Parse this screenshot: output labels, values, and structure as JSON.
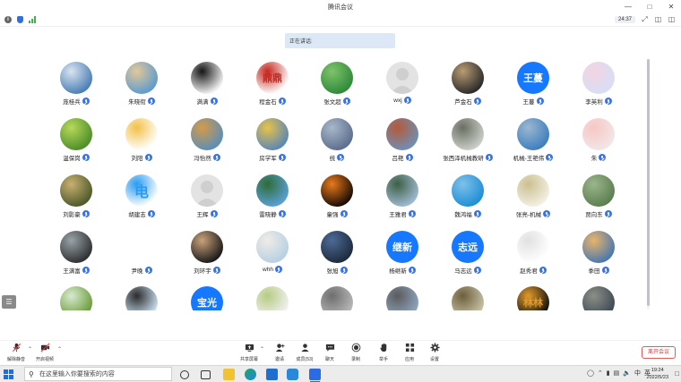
{
  "window": {
    "title": "腾讯会议",
    "timer": "24:37"
  },
  "speaking": {
    "label": "正在讲话:"
  },
  "participants": [
    {
      "name": "庞桂兵",
      "avatar": "sky-clouds",
      "colors": [
        "#4b7fb5",
        "#d9e4f0"
      ]
    },
    {
      "name": "朱晓衔",
      "avatar": "beach-person",
      "colors": [
        "#5e9bcf",
        "#e3c898"
      ]
    },
    {
      "name": "满满",
      "avatar": "black-cat",
      "colors": [
        "#f3f3f3",
        "#151515"
      ]
    },
    {
      "name": "程金石",
      "avatar": "red-seal",
      "colors": [
        "#ffffff",
        "#c4271e"
      ],
      "text": "鼎鼎",
      "text_color": "#c4271e"
    },
    {
      "name": "张文超",
      "avatar": "bamboo",
      "colors": [
        "#2f8a3a",
        "#7fc36a"
      ]
    },
    {
      "name": "wxj",
      "avatar": "default-person",
      "colors": [
        "#e3e3e3",
        "#c7c7c7"
      ]
    },
    {
      "name": "芦金石",
      "avatar": "person-portrait",
      "colors": [
        "#2b2b2b",
        "#b89b72"
      ]
    },
    {
      "name": "王蔓",
      "avatar": "text",
      "colors": [
        "#1677ff",
        "#1677ff"
      ],
      "text": "王蔓"
    },
    {
      "name": "李英利",
      "avatar": "cartoon-girl",
      "colors": [
        "#d7def6",
        "#f3d4e2"
      ]
    },
    {
      "name": "温保岗",
      "avatar": "green-leaf",
      "colors": [
        "#4d8f2a",
        "#b7d95a"
      ]
    },
    {
      "name": "刘阳",
      "avatar": "baby-crown",
      "colors": [
        "#ffffff",
        "#f2c14b"
      ]
    },
    {
      "name": "冯怡然",
      "avatar": "painting",
      "colors": [
        "#5b8fb7",
        "#d49a4a"
      ]
    },
    {
      "name": "房学军",
      "avatar": "sunflower-burst",
      "colors": [
        "#5b87b8",
        "#e7c24a"
      ]
    },
    {
      "name": "统",
      "avatar": "sea-dusk",
      "colors": [
        "#5d6f8f",
        "#a8b7c9"
      ]
    },
    {
      "name": "吕艳",
      "avatar": "temple",
      "colors": [
        "#6f8fb5",
        "#b45a3a"
      ]
    },
    {
      "name": "张西泽机械教研",
      "avatar": "stone-arch",
      "colors": [
        "#c9cfc8",
        "#6b6f63"
      ]
    },
    {
      "name": "机械-王艳伟",
      "avatar": "city-lake",
      "colors": [
        "#3f7fbf",
        "#9cb7d0"
      ]
    },
    {
      "name": "朱",
      "avatar": "cartoon-kid",
      "colors": [
        "#f2e6e6",
        "#f6c7c4"
      ]
    },
    {
      "name": "刘影豪",
      "avatar": "field",
      "colors": [
        "#4e5a2c",
        "#c9b070"
      ]
    },
    {
      "name": "胡建志",
      "avatar": "blue-char",
      "colors": [
        "#ffffff",
        "#2a9bf0"
      ],
      "text": "电",
      "text_color": "#2a9bf0"
    },
    {
      "name": "王辉",
      "avatar": "default-person",
      "colors": [
        "#e3e3e3",
        "#c7c7c7"
      ]
    },
    {
      "name": "雷晓静",
      "avatar": "palm-beach",
      "colors": [
        "#5aa0d6",
        "#2e6b36"
      ]
    },
    {
      "name": "童强",
      "avatar": "fire",
      "colors": [
        "#1a0c05",
        "#e87a1c"
      ]
    },
    {
      "name": "王雅君",
      "avatar": "mountain-lake",
      "colors": [
        "#9fb9cf",
        "#3d5f46"
      ]
    },
    {
      "name": "魏鸿福",
      "avatar": "island-sea",
      "colors": [
        "#1f8fd6",
        "#7ec1e8"
      ]
    },
    {
      "name": "张亮-机械",
      "avatar": "sketch-figure",
      "colors": [
        "#f3efe2",
        "#cbbf91"
      ]
    },
    {
      "name": "贾向东",
      "avatar": "river-trees",
      "colors": [
        "#5c7f52",
        "#9bb58a"
      ]
    },
    {
      "name": "王满富",
      "avatar": "forest-light",
      "colors": [
        "#2f3133",
        "#9aa3a7"
      ]
    },
    {
      "name": "尹晚",
      "avatar": "none",
      "colors": [
        "#ffffff",
        "#ffffff"
      ]
    },
    {
      "name": "刘环宇",
      "avatar": "man-portrait",
      "colors": [
        "#1b1b1b",
        "#caa27a"
      ]
    },
    {
      "name": "whh",
      "avatar": "girl-beach",
      "colors": [
        "#b7d0e3",
        "#f0ece6"
      ]
    },
    {
      "name": "张旭",
      "avatar": "berries",
      "colors": [
        "#1e2b3e",
        "#4d6a96"
      ]
    },
    {
      "name": "杨继新",
      "avatar": "text",
      "colors": [
        "#1677ff",
        "#1677ff"
      ],
      "text": "继新"
    },
    {
      "name": "马志远",
      "avatar": "text",
      "colors": [
        "#1677ff",
        "#1677ff"
      ],
      "text": "志远"
    },
    {
      "name": "赵秀君",
      "avatar": "panda-flowers",
      "colors": [
        "#ffffff",
        "#e1e1e1"
      ]
    },
    {
      "name": "季田",
      "avatar": "sunset-lake",
      "colors": [
        "#4a78b0",
        "#e9b46a"
      ]
    },
    {
      "name": "",
      "avatar": "sprout",
      "colors": [
        "#6a9c3a",
        "#d8ead0"
      ]
    },
    {
      "name": "",
      "avatar": "dancer-silhouette",
      "colors": [
        "#c9dff0",
        "#2b2b2b"
      ]
    },
    {
      "name": "",
      "avatar": "text",
      "colors": [
        "#1677ff",
        "#1677ff"
      ],
      "text": "宝光"
    },
    {
      "name": "",
      "avatar": "flowers",
      "colors": [
        "#f1f1f1",
        "#b7cb84"
      ]
    },
    {
      "name": "",
      "avatar": "gears",
      "colors": [
        "#b8b8b8",
        "#6e6e6e"
      ]
    },
    {
      "name": "",
      "avatar": "city-street",
      "colors": [
        "#8fa5bf",
        "#5b5b5b"
      ]
    },
    {
      "name": "",
      "avatar": "windmill",
      "colors": [
        "#c7c2a8",
        "#6d5f3c"
      ]
    },
    {
      "name": "",
      "avatar": "logo-box",
      "colors": [
        "#111111",
        "#e39b2a"
      ],
      "text": "林林",
      "text_color": "#e39b2a"
    },
    {
      "name": "",
      "avatar": "dark-scene",
      "colors": [
        "#3c4a55",
        "#8d8f86"
      ]
    }
  ],
  "toolbar": {
    "left": [
      {
        "label": "解除静音",
        "icon": "mic-muted-icon"
      },
      {
        "label": "开启视频",
        "icon": "video-off-icon"
      }
    ],
    "center": [
      {
        "label": "共享屏幕",
        "icon": "share-screen-icon"
      },
      {
        "label": "邀请",
        "icon": "invite-icon"
      },
      {
        "label": "成员(53)",
        "icon": "members-icon"
      },
      {
        "label": "聊天",
        "icon": "chat-icon"
      },
      {
        "label": "录制",
        "icon": "record-icon"
      },
      {
        "label": "举手",
        "icon": "raise-hand-icon"
      },
      {
        "label": "应用",
        "icon": "apps-icon"
      },
      {
        "label": "设置",
        "icon": "gear-icon"
      }
    ],
    "leave": "离开会议"
  },
  "taskbar": {
    "search_placeholder": "在这里输入你要搜索的内容",
    "time": "19:24",
    "date": "2022/5/23",
    "ime": "中",
    "input_mode": "英"
  },
  "colors": {
    "accent": "#1677ff",
    "mic_badge": "#3a73e8",
    "leave": "#e03b3b"
  }
}
